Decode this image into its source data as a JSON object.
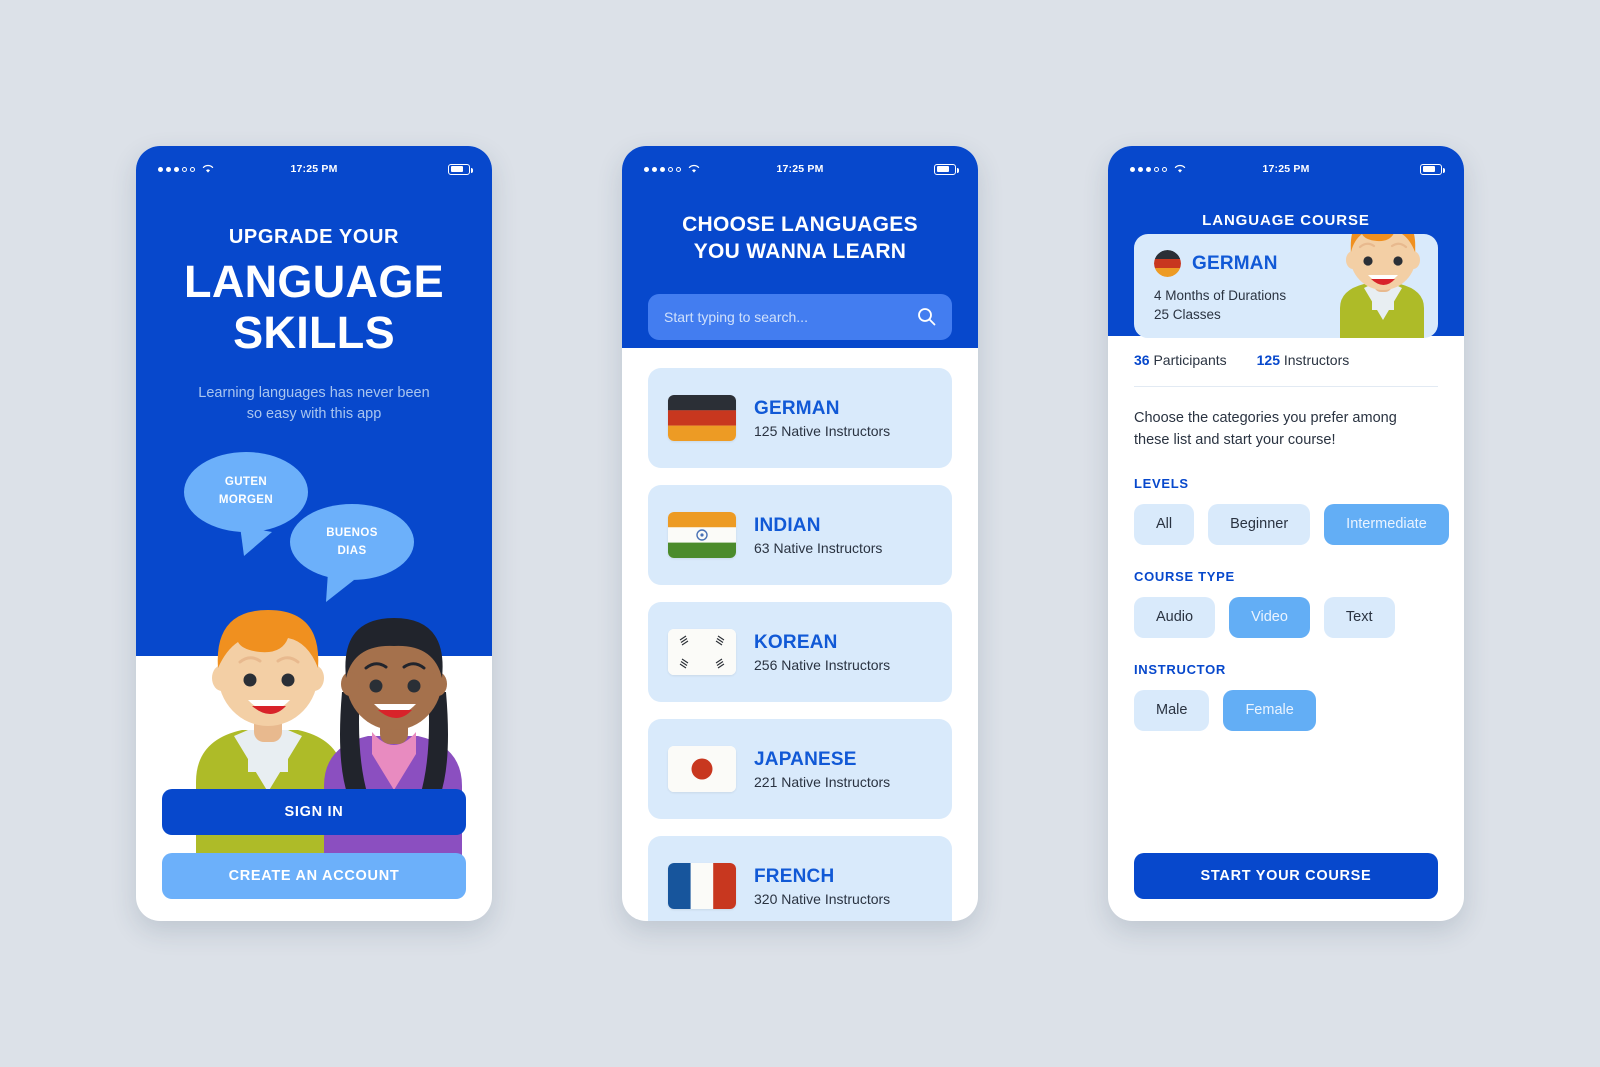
{
  "colors": {
    "primary_blue": "#0748CC",
    "light_blue_card": "#D9EAFB",
    "chip_selected": "#63AEF5",
    "secondary_button": "#6CB0FA",
    "page_background": "#DCE1E8",
    "link_blue": "#1159D6"
  },
  "status_bar": {
    "time": "17:25 PM",
    "signal_dots_filled": 3,
    "signal_dots_hollow": 2,
    "wifi_icon": "wifi-icon",
    "battery_icon": "battery-icon",
    "battery_level_percent": 72
  },
  "screen1": {
    "kicker": "UPGRADE YOUR",
    "title_line1": "LANGUAGE",
    "title_line2": "SKILLS",
    "subtitle": "Learning languages has never been so easy with this app",
    "bubble1_line1": "GUTEN",
    "bubble1_line2": "MORGEN",
    "bubble2_line1": "BUENOS",
    "bubble2_line2": "DIAS",
    "sign_in_label": "SIGN IN",
    "create_account_label": "CREATE AN ACCOUNT"
  },
  "screen2": {
    "title_line1": "CHOOSE LANGUAGES",
    "title_line2": "YOU WANNA LEARN",
    "search_placeholder": "Start typing to search...",
    "search_icon": "search-icon",
    "languages": [
      {
        "name": "GERMAN",
        "instructors": "125 Native Instructors",
        "flag": "flag-germany"
      },
      {
        "name": "INDIAN",
        "instructors": "63 Native Instructors",
        "flag": "flag-india"
      },
      {
        "name": "KOREAN",
        "instructors": "256 Native Instructors",
        "flag": "flag-south-korea"
      },
      {
        "name": "JAPANESE",
        "instructors": "221 Native Instructors",
        "flag": "flag-japan"
      },
      {
        "name": "FRENCH",
        "instructors": "320 Native Instructors",
        "flag": "flag-france"
      }
    ]
  },
  "screen3": {
    "header_title": "LANGUAGE COURSE",
    "course": {
      "flag": "flag-germany-circle",
      "name": "GERMAN",
      "duration": "4 Months of Durations",
      "classes": "25 Classes"
    },
    "stats": {
      "participants_count": "36",
      "participants_label": "Participants",
      "instructors_count": "125",
      "instructors_label": "Instructors"
    },
    "lead": "Choose the categories you prefer among these list and start your course!",
    "sections": [
      {
        "label": "LEVELS",
        "options": [
          {
            "label": "All",
            "selected": false
          },
          {
            "label": "Beginner",
            "selected": false
          },
          {
            "label": "Intermediate",
            "selected": true
          }
        ]
      },
      {
        "label": "COURSE TYPE",
        "options": [
          {
            "label": "Audio",
            "selected": false
          },
          {
            "label": "Video",
            "selected": true
          },
          {
            "label": "Text",
            "selected": false
          }
        ]
      },
      {
        "label": "INSTRUCTOR",
        "options": [
          {
            "label": "Male",
            "selected": false
          },
          {
            "label": "Female",
            "selected": true
          }
        ]
      }
    ],
    "start_button_label": "START YOUR COURSE"
  }
}
